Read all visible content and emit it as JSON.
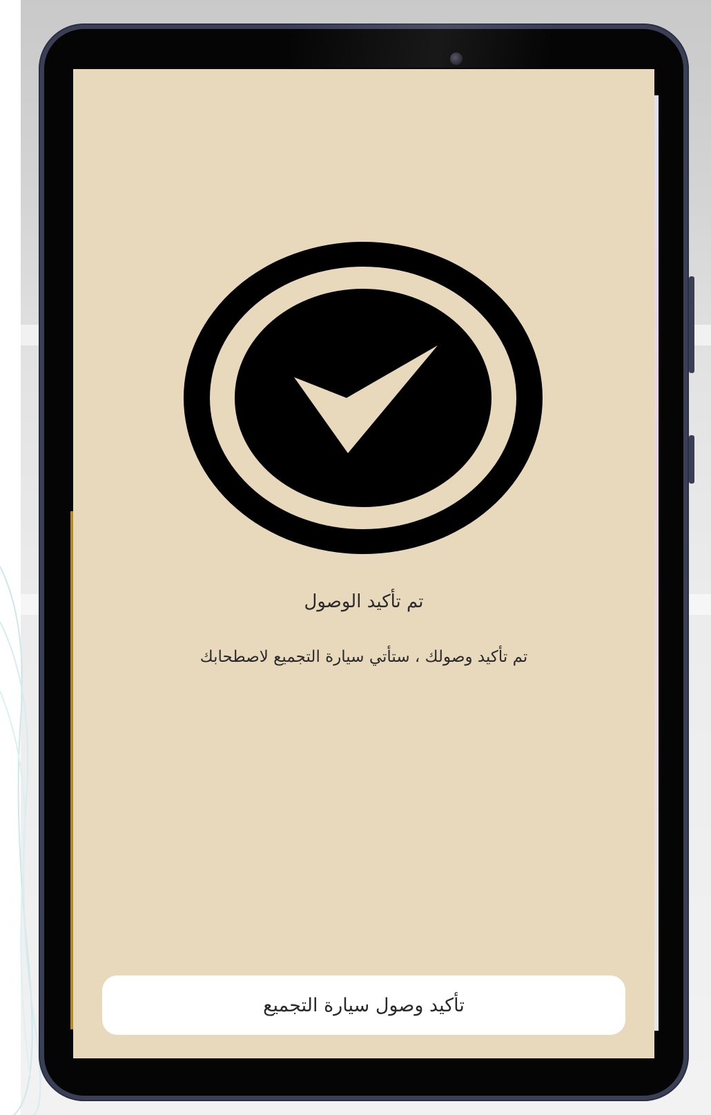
{
  "screen": {
    "background_color": "#e8d9bc",
    "icon": "check-circle-icon",
    "title": "تم تأكيد الوصول",
    "message": "تم تأكيد وصولك ، ستأتي سيارة التجميع لاصطحابك",
    "confirm_button_label": "تأكيد وصول سيارة التجميع"
  },
  "device": {
    "frame_color": "#3a3f56",
    "bezel_color": "#050505"
  },
  "colors": {
    "icon": "#000000",
    "text": "#2a2a2a",
    "button_background": "#ffffff"
  }
}
